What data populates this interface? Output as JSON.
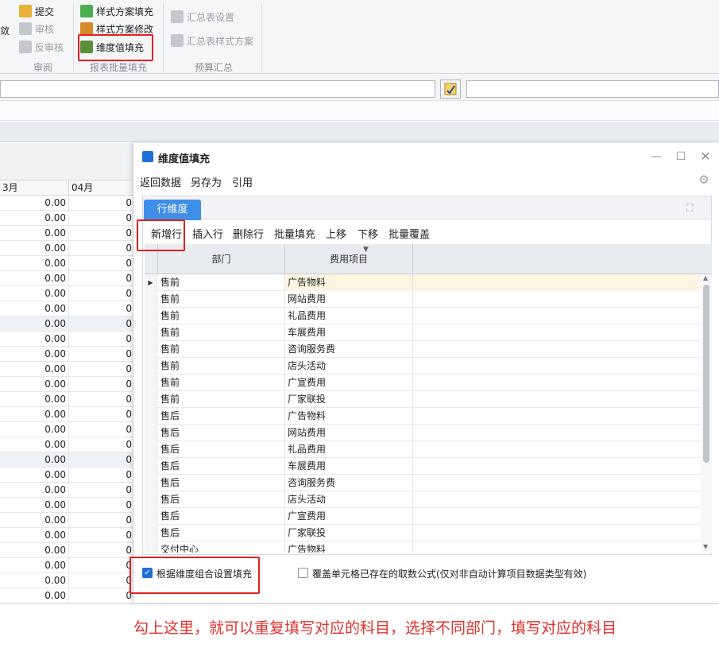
{
  "ribbon": {
    "review": {
      "submit": "提交",
      "audit": "审核",
      "unaudit": "反审核",
      "group": "审阅"
    },
    "batch": {
      "style_fill": "样式方案填充",
      "style_edit": "样式方案修改",
      "dim_fill": "维度值填充",
      "group": "报表批量填充"
    },
    "summary": {
      "table_settings": "汇总表设置",
      "style_plan": "汇总表样式方案",
      "group": "预算汇总"
    }
  },
  "sheet": {
    "col_prev": "3月",
    "col_apr": "04月",
    "cell_value": "0.00",
    "cell_value_clipped": "0"
  },
  "dialog": {
    "title": "维度值填充",
    "menu": [
      "返回数据",
      "另存为",
      "引用"
    ],
    "tab": "行维度",
    "toolbar": [
      "新增行",
      "插入行",
      "删除行",
      "批量填充",
      "上移",
      "下移",
      "批量覆盖"
    ],
    "columns": {
      "dept": "部门",
      "item": "费用项目"
    },
    "rows": [
      {
        "dept": "售前",
        "item": "广告物料"
      },
      {
        "dept": "售前",
        "item": "网站费用"
      },
      {
        "dept": "售前",
        "item": "礼品费用"
      },
      {
        "dept": "售前",
        "item": "车展费用"
      },
      {
        "dept": "售前",
        "item": "咨询服务费"
      },
      {
        "dept": "售前",
        "item": "店头活动"
      },
      {
        "dept": "售前",
        "item": "广宣费用"
      },
      {
        "dept": "售前",
        "item": "厂家联投"
      },
      {
        "dept": "售后",
        "item": "广告物料"
      },
      {
        "dept": "售后",
        "item": "网站费用"
      },
      {
        "dept": "售后",
        "item": "礼品费用"
      },
      {
        "dept": "售后",
        "item": "车展费用"
      },
      {
        "dept": "售后",
        "item": "咨询服务费"
      },
      {
        "dept": "售后",
        "item": "店头活动"
      },
      {
        "dept": "售后",
        "item": "广宣费用"
      },
      {
        "dept": "售后",
        "item": "厂家联投"
      },
      {
        "dept": "交付中心",
        "item": "广告物料"
      }
    ],
    "check_combo": {
      "label": "根据维度组合设置填充",
      "checked": true
    },
    "check_overwrite": {
      "label": "覆盖单元格已存在的取数公式(仅对非自动计算项目数据类型有效)",
      "checked": false
    }
  },
  "annotation": "勾上这里，就可以重复填写对应的科目，选择不同部门，填写对应的科目",
  "colors": {
    "accent": "#3f8ee8",
    "highlight": "#e02020",
    "selected_row": "#fdf5e1"
  }
}
